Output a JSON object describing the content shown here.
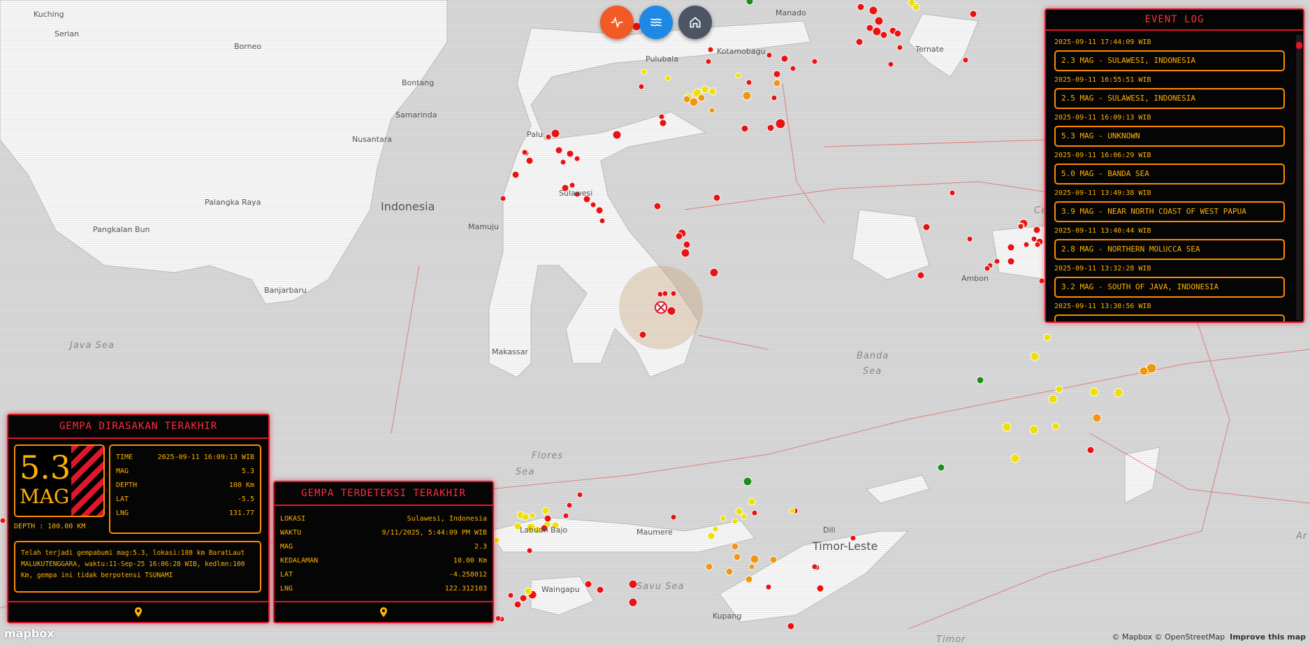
{
  "map": {
    "places": [
      "Kuching",
      "Serian",
      "Borneo",
      "Bontang",
      "Samarinda",
      "Nusantara",
      "Indonesia",
      "Palangka Raya",
      "Pangkalan Bun",
      "Banjarbaru",
      "Java Sea",
      "Makassar",
      "Palu",
      "Mamuju",
      "Sulawesi",
      "Pulubala",
      "Kotamobagu",
      "Manado",
      "Ternate",
      "Ambon",
      "Banda",
      "Sea",
      "Flores",
      "Sea",
      "Savu Sea",
      "Labuan Bajo",
      "Maumere",
      "Dili",
      "Timor-Leste",
      "Kupang",
      "Waingapu",
      "Timor",
      "Ceram",
      "Ar"
    ],
    "attribution": "© Mapbox © OpenStreetMap",
    "improve": "Improve this map",
    "logo": "mapbox"
  },
  "toolbar": {
    "activity_icon": "activity-icon",
    "waves_icon": "waves-icon",
    "home_icon": "home-icon",
    "colors": {
      "activity": "#f15a24",
      "waves": "#1e88e5",
      "home": "#4b5563"
    }
  },
  "felt": {
    "title": "GEMPA DIRASAKAN TERAKHIR",
    "mag_value": "5.3",
    "mag_label": "MAG",
    "depth_line": "DEPTH : 100.00 KM",
    "rows": [
      {
        "label": "TIME",
        "value": "2025-09-11 16:09:13 WIB"
      },
      {
        "label": "MAG",
        "value": "5.3"
      },
      {
        "label": "DEPTH",
        "value": "100 Km"
      },
      {
        "label": "LAT",
        "value": "-5.5"
      },
      {
        "label": "LNG",
        "value": "131.77"
      }
    ],
    "description": "Telah terjadi gempabumi mag:5.3, lokasi:108 km BaratLaut MALUKUTENGGARA, waktu:11-Sep-25 16:06:28 WIB, kedlmn:100 Km, gempa ini tidak berpotensi TSUNAMI",
    "footer_icon": "map-pin-icon"
  },
  "detected": {
    "title": "GEMPA TERDETEKSI TERAKHIR",
    "rows": [
      {
        "label": "LOKASI",
        "value": "Sulawesi, Indonesia"
      },
      {
        "label": "WAKTU",
        "value": "9/11/2025, 5:44:09 PM WIB"
      },
      {
        "label": "MAG",
        "value": "2.3"
      },
      {
        "label": "KEDALAMAN",
        "value": "10.00 Km"
      },
      {
        "label": "LAT",
        "value": "-4.258012"
      },
      {
        "label": "LNG",
        "value": "122.312103"
      }
    ],
    "footer_icon": "map-pin-icon"
  },
  "event_log": {
    "title": "EVENT LOG",
    "events": [
      {
        "time": "2025-09-11 17:44:09 WIB",
        "text": "2.3 MAG - SULAWESI, INDONESIA"
      },
      {
        "time": "2025-09-11 16:55:51 WIB",
        "text": "2.5 MAG - SULAWESI, INDONESIA"
      },
      {
        "time": "2025-09-11 16:09:13 WIB",
        "text": "5.3 MAG - UNKNOWN"
      },
      {
        "time": "2025-09-11 16:06:29 WIB",
        "text": "5.0 MAG - BANDA SEA"
      },
      {
        "time": "2025-09-11 13:49:38 WIB",
        "text": "3.9 MAG - NEAR NORTH COAST OF WEST PAPUA"
      },
      {
        "time": "2025-09-11 13:40:44 WIB",
        "text": "2.8 MAG - NORTHERN MOLUCCA SEA"
      },
      {
        "time": "2025-09-11 13:32:28 WIB",
        "text": "3.2 MAG - SOUTH OF JAVA, INDONESIA"
      },
      {
        "time": "2025-09-11 13:30:56 WIB",
        "text": ""
      }
    ]
  }
}
